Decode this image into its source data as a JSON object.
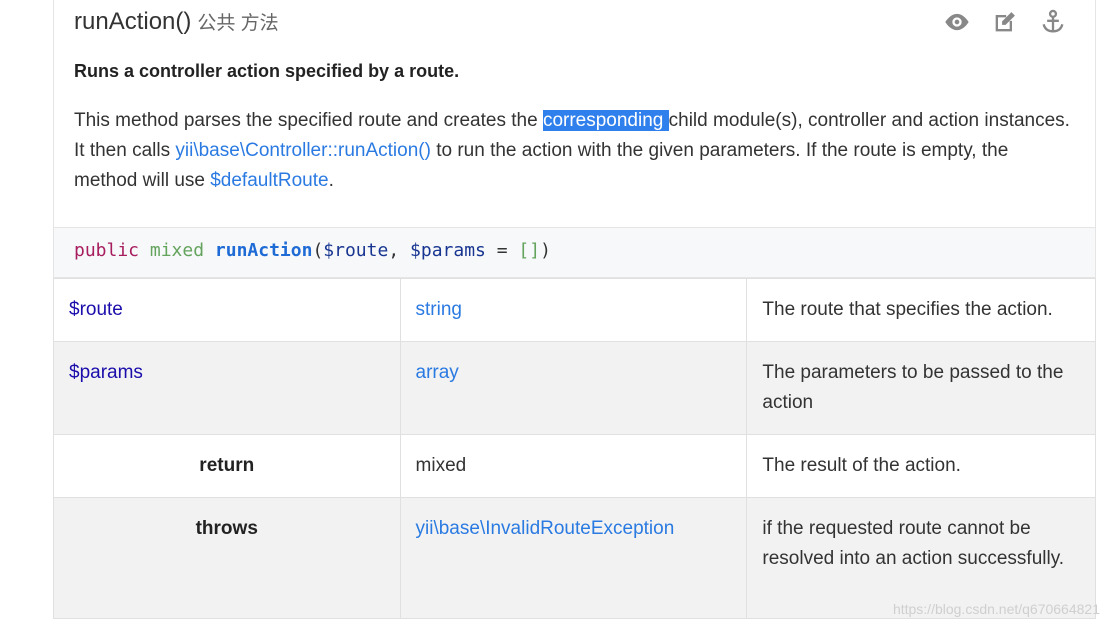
{
  "header": {
    "method_name": "runAction()",
    "method_kind": "公共 方法",
    "icons": [
      "eye-icon",
      "edit-icon",
      "anchor-icon"
    ]
  },
  "summary": "Runs a controller action specified by a route.",
  "description": {
    "part1": "This method parses the specified route and creates the ",
    "highlight": "corresponding ",
    "part2": "child module(s), controller and action instances. It then calls ",
    "link1": "yii\\base\\Controller::runAction()",
    "part3": " to run the action with the given parameters. If the route is empty, the method will use ",
    "link2": "$defaultRoute",
    "part4": "."
  },
  "signature": {
    "kw": "public",
    "type": "mixed",
    "fn": "runAction",
    "open": "(",
    "p1": "$route",
    "comma": ", ",
    "p2": "$params",
    "eq": " = ",
    "def": "[]",
    "close": ")"
  },
  "rows": [
    {
      "name": "$route",
      "type": "string",
      "desc": "The route that specifies the action."
    },
    {
      "name": "$params",
      "type": "array",
      "desc": "The parameters to be passed to the action"
    },
    {
      "name": "return",
      "type": "mixed",
      "desc": "The result of the action."
    },
    {
      "name": "throws",
      "type": "yii\\base\\InvalidRouteException",
      "desc": "if the requested route cannot be resolved into an action successfully."
    }
  ],
  "watermark": "https://blog.csdn.net/q670664821",
  "colors": {
    "link": "#2a7ae2",
    "highlight": "#2f80ed"
  }
}
